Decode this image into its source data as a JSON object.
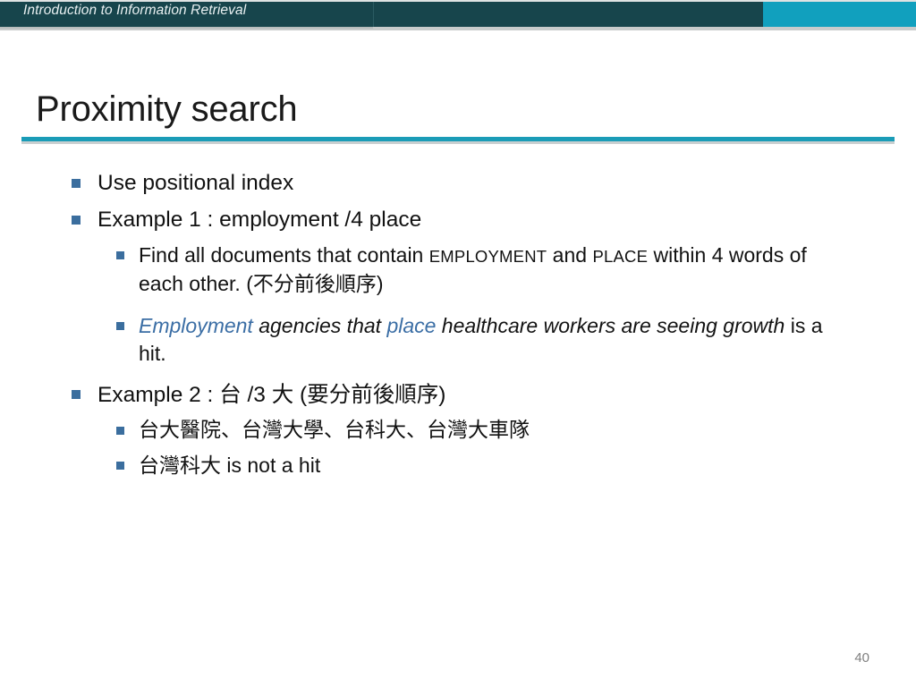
{
  "header": {
    "title": "Introduction to Information Retrieval",
    "dark_color": "#17454c",
    "accent_color": "#11a0be"
  },
  "slide": {
    "title": "Proximity search",
    "rule_color": "#1a9cb7",
    "page_number": "40"
  },
  "bullets": {
    "b1": "Use positional index",
    "b2": "Example 1 : employment /4 place",
    "b3_a": "Find all documents that contain ",
    "b3_sc1": "EMPLOYMENT",
    "b3_b": " and ",
    "b3_sc2": "PLACE",
    "b3_c": " within 4 words of each other. (",
    "b3_cjk": "不分前後順序",
    "b3_d": ")",
    "b4_blue1": "Employment",
    "b4_a": " agencies that ",
    "b4_blue2": "place",
    "b4_b": " healthcare workers are seeing growth",
    "b4_c": " is a hit.",
    "b5_a": "Example 2 : ",
    "b5_cjk1": "台",
    "b5_b": " /3 ",
    "b5_cjk2": "大",
    "b5_c": " (",
    "b5_cjk3": "要分前後順序",
    "b5_d": ")",
    "b6_cjk": "台大醫院、台灣大學、台科大、台灣大車隊",
    "b7_cjk": "台灣科大",
    "b7_text": " is not a hit"
  },
  "colors": {
    "bullet_marker": "#3b6e9e",
    "emphasis_blue": "#3b6ea5",
    "page_number": "#808080"
  }
}
